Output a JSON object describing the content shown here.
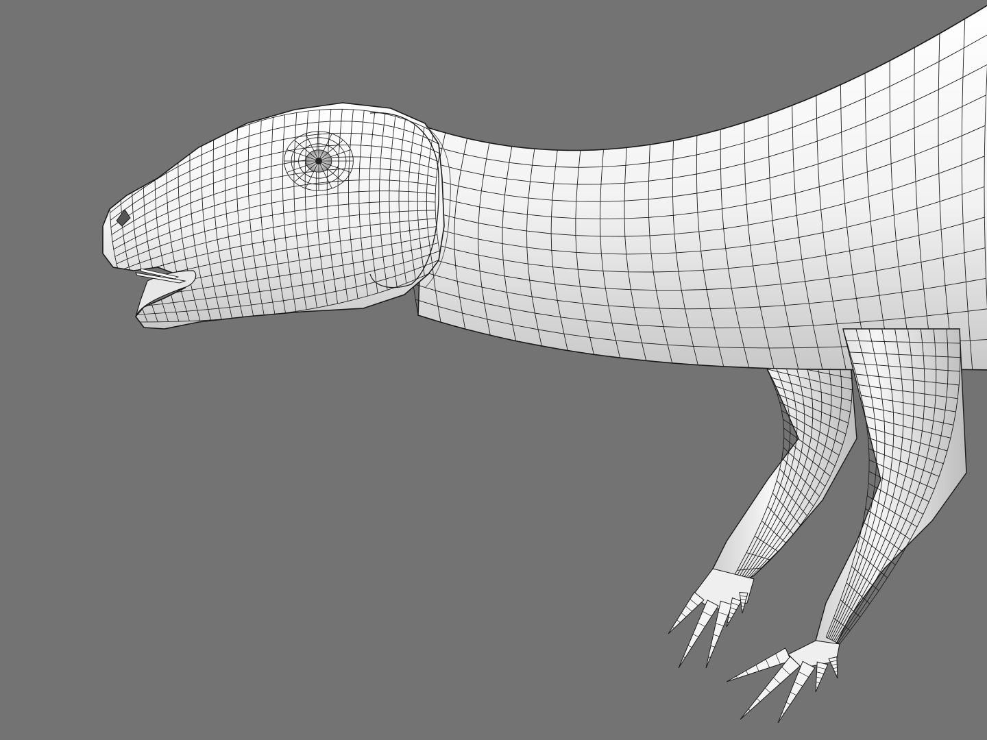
{
  "viewport": {
    "background": "#737373",
    "subject": "dinosaur-wireframe-mesh",
    "shading": "clay-white-smooth",
    "wire_color": "#1a1a1a",
    "surface_color": "#f4f4f4",
    "shadow_color": "#c4c4c4"
  }
}
